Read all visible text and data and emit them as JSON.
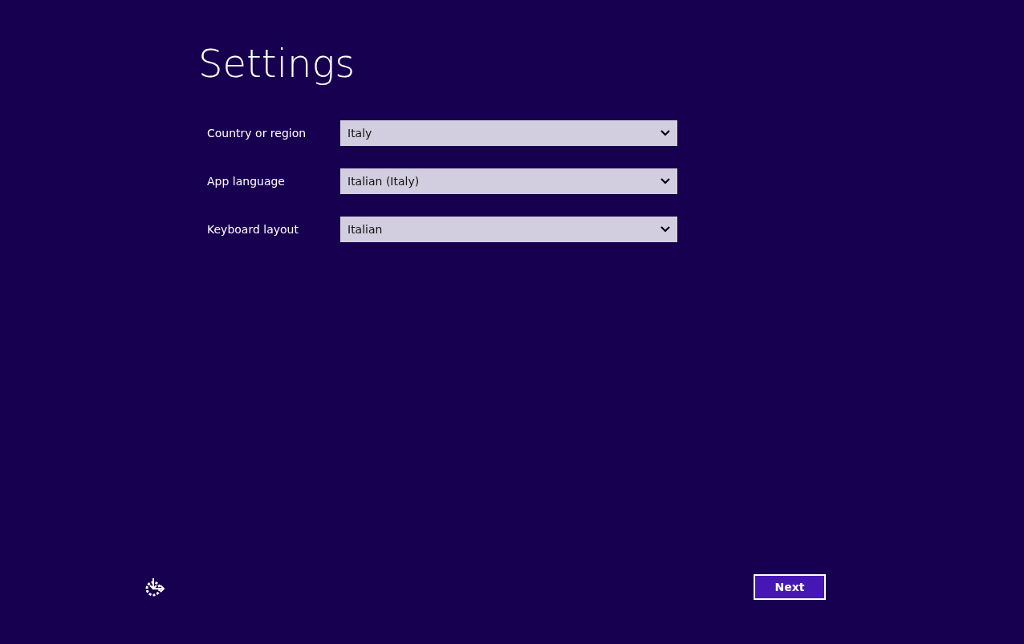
{
  "title": "Settings",
  "fields": [
    {
      "label": "Country or region",
      "value": "Italy"
    },
    {
      "label": "App language",
      "value": "Italian (Italy)"
    },
    {
      "label": "Keyboard layout",
      "value": "Italian"
    }
  ],
  "next_button": "Next"
}
